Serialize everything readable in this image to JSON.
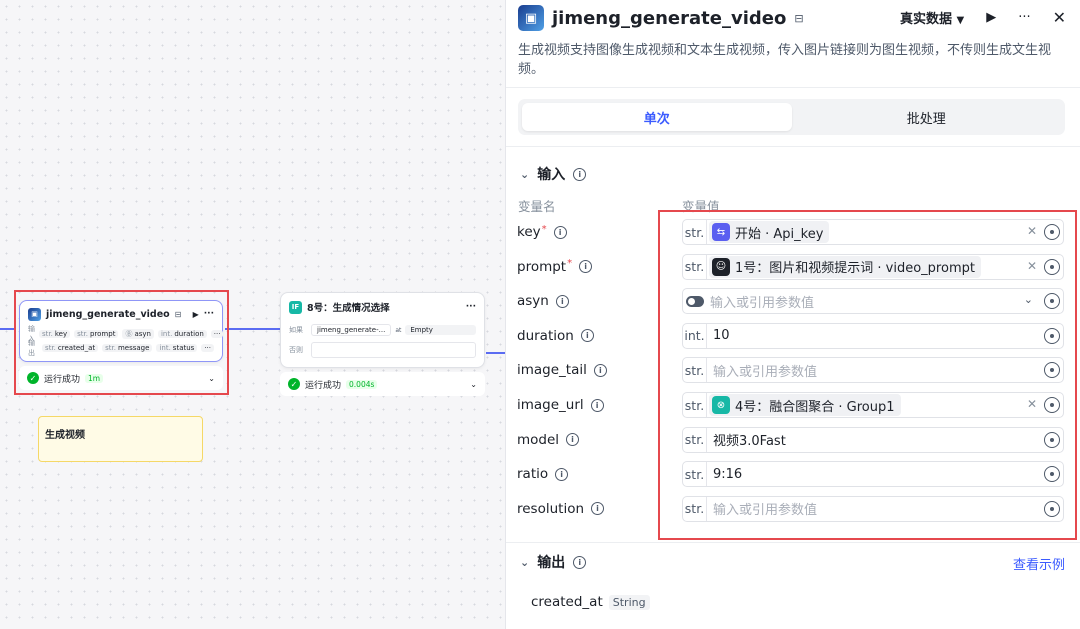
{
  "canvas": {
    "node1": {
      "title": "jimeng_generate_video",
      "lock_icon": "lock-icon",
      "input_label": "输入",
      "output_label": "输出",
      "inputs": [
        {
          "type": "str.",
          "name": "key"
        },
        {
          "type": "str.",
          "name": "prompt"
        },
        {
          "type": "Ⓑ",
          "name": "asyn"
        },
        {
          "type": "int.",
          "name": "duration"
        }
      ],
      "outputs": [
        {
          "type": "str.",
          "name": "created_at"
        },
        {
          "type": "str.",
          "name": "message"
        },
        {
          "type": "int.",
          "name": "status"
        }
      ],
      "status_text": "运行成功",
      "status_time": "1m"
    },
    "node2": {
      "title": "8号：生成情况选择",
      "icon_text": "IF",
      "if_label": "如果",
      "else_label": "否则",
      "cond_left": "jimeng_generate-...",
      "cond_op": "at",
      "cond_right": "Empty",
      "status_text": "运行成功",
      "status_time": "0.004s"
    },
    "note": {
      "text": "生成视频"
    }
  },
  "panel": {
    "title": "jimeng_generate_video",
    "data_mode": "真实数据",
    "description": "生成视频支持图像生成视频和文本生成视频，传入图片链接则为图生视频，不传则生成文生视频。",
    "tabs": [
      "单次",
      "批处理"
    ],
    "input_section": "输入",
    "col_name": "变量名",
    "col_value": "变量值",
    "placeholder": "输入或引用参数值",
    "params": [
      {
        "name": "key",
        "required": true,
        "type": "str.",
        "kind": "ref",
        "ref_icon": "start-icon",
        "ref_color": "#5b5ff0",
        "ref_text": "开始 · Api_key"
      },
      {
        "name": "prompt",
        "required": true,
        "type": "str.",
        "kind": "ref",
        "ref_icon": "llm-icon",
        "ref_color": "#1d2129",
        "ref_text": "1号：图片和视频提示词 · video_prompt"
      },
      {
        "name": "asyn",
        "required": false,
        "type": "",
        "kind": "toggle",
        "ref_text": "输入或引用参数值"
      },
      {
        "name": "duration",
        "required": false,
        "type": "int.",
        "kind": "value",
        "ref_text": "10"
      },
      {
        "name": "image_tail",
        "required": false,
        "type": "str.",
        "kind": "placeholder",
        "ref_text": "输入或引用参数值"
      },
      {
        "name": "image_url",
        "required": false,
        "type": "str.",
        "kind": "ref",
        "ref_icon": "merge-icon",
        "ref_color": "#17b8a6",
        "ref_text": "4号：融合图聚合 · Group1"
      },
      {
        "name": "model",
        "required": false,
        "type": "str.",
        "kind": "value",
        "ref_text": "视频3.0Fast"
      },
      {
        "name": "ratio",
        "required": false,
        "type": "str.",
        "kind": "value",
        "ref_text": "9:16"
      },
      {
        "name": "resolution",
        "required": false,
        "type": "str.",
        "kind": "placeholder",
        "ref_text": "输入或引用参数值"
      }
    ],
    "output_section": "输出",
    "view_example": "查看示例",
    "outputs": [
      {
        "name": "created_at",
        "type": "String"
      }
    ]
  }
}
